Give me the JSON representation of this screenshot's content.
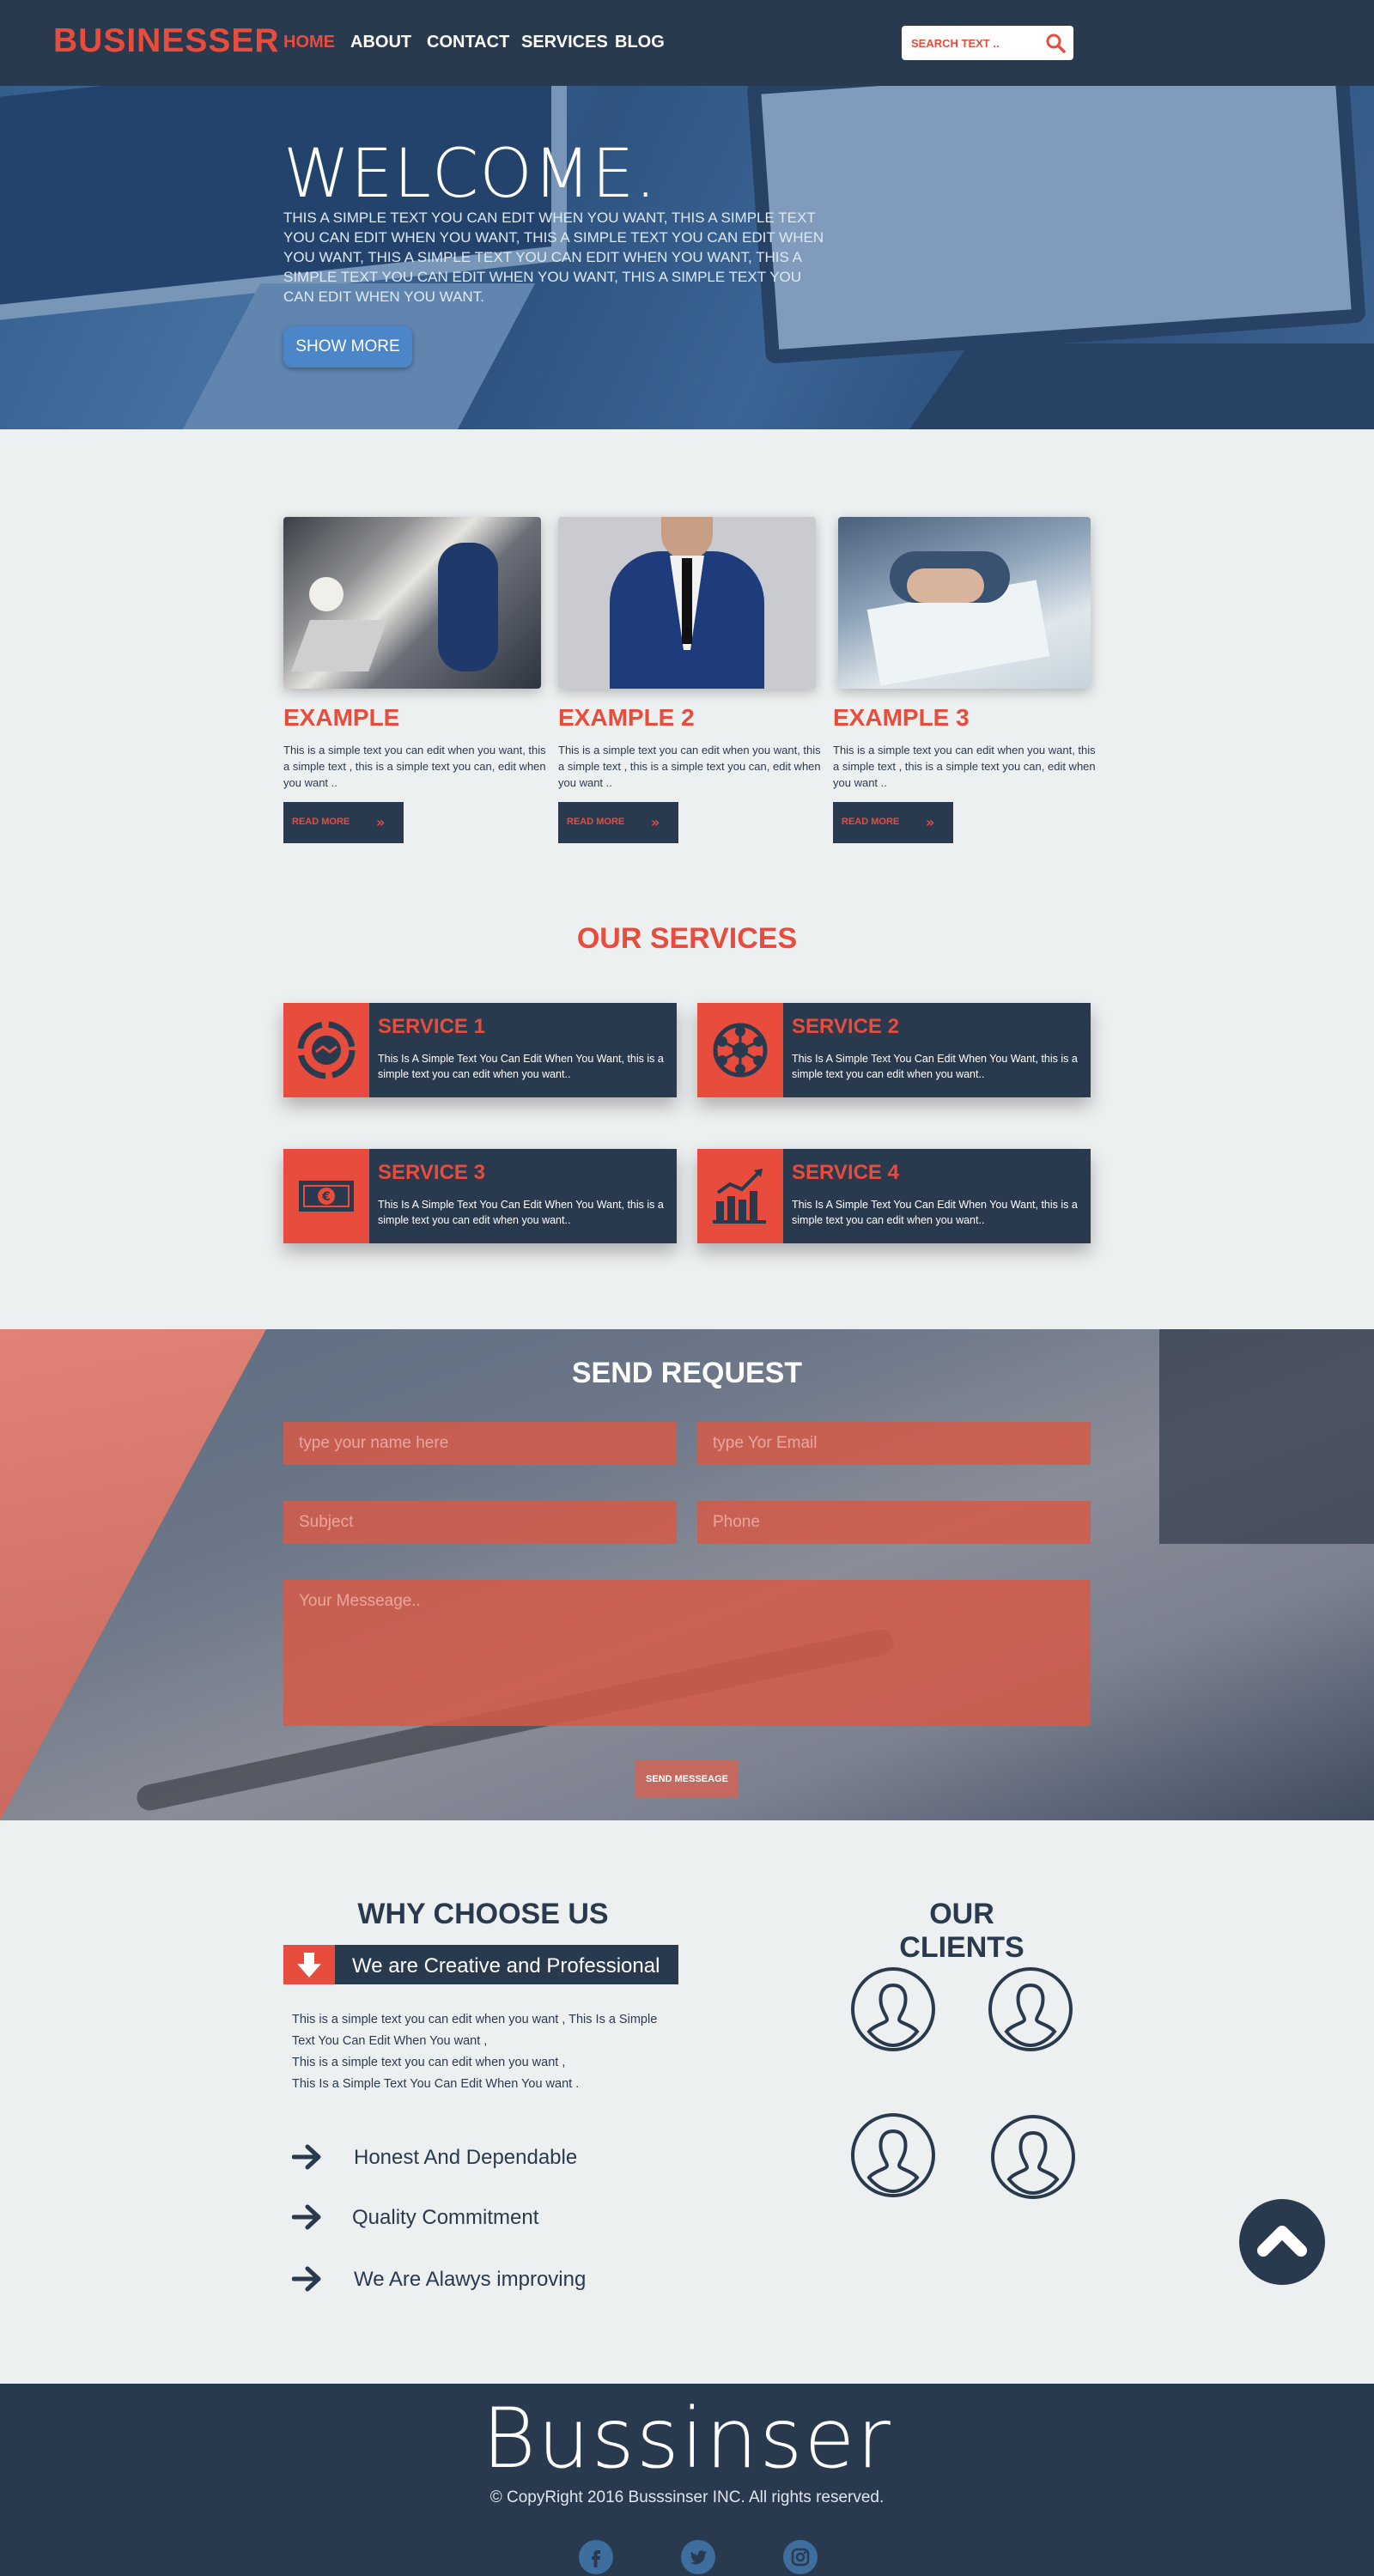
{
  "header": {
    "logo": "BUSINESSER",
    "nav": [
      "HOME",
      "ABOUT",
      "CONTACT",
      "SERVICES",
      "BLOG"
    ],
    "active_nav": "HOME",
    "search_placeholder": "SEARCH TEXT ..",
    "search_icon": "search-icon"
  },
  "hero": {
    "title": "WELCOME.",
    "text": "THIS A SIMPLE TEXT YOU CAN EDIT WHEN YOU WANT, THIS A SIMPLE TEXT YOU CAN EDIT WHEN YOU WANT, THIS A SIMPLE TEXT YOU CAN EDIT WHEN YOU WANT, THIS A SIMPLE TEXT YOU CAN EDIT WHEN YOU WANT, THIS A SIMPLE TEXT YOU CAN EDIT WHEN YOU WANT, THIS A SIMPLE TEXT YOU CAN EDIT WHEN YOU WANT.",
    "button": "SHOW MORE"
  },
  "examples": [
    {
      "title": "EXAMPLE",
      "text": "This is a simple text you can edit when you want, this a simple text , this is a simple text you can, edit when you want ..",
      "button": "READ MORE"
    },
    {
      "title": "EXAMPLE 2",
      "text": "This is a simple text you can edit when you want, this a simple text , this is a simple text you can, edit when you want ..",
      "button": "READ MORE"
    },
    {
      "title": "EXAMPLE 3",
      "text": "This is a simple text you can edit when you want, this a simple text , this is a simple text you can, edit when you want ..",
      "button": "READ MORE"
    }
  ],
  "services": {
    "title": "OUR SERVICES",
    "items": [
      {
        "title": "SERVICE 1",
        "text": "This Is A Simple Text You Can Edit When You Want, this is a simple text you can edit when you want..",
        "icon": "handshake-icon"
      },
      {
        "title": "SERVICE 2",
        "text": "This Is A Simple Text You Can Edit When You Want, this is a simple text you can edit when you want..",
        "icon": "network-icon"
      },
      {
        "title": "SERVICE 3",
        "text": "This Is A Simple Text You Can Edit When You Want, this is a simple text you can edit when you want..",
        "icon": "euro-banknote-icon"
      },
      {
        "title": "SERVICE 4",
        "text": "This Is A Simple Text You Can Edit When You Want, this is a simple text you can edit when you want..",
        "icon": "growth-chart-icon"
      }
    ]
  },
  "request": {
    "title": "SEND REQUEST",
    "name_placeholder": "type your name here",
    "email_placeholder": "type Yor Email",
    "subject_placeholder": "Subject",
    "phone_placeholder": "Phone",
    "message_placeholder": "Your Messeage..",
    "button": "SEND MESSEAGE"
  },
  "why": {
    "title": "WHY CHOOSE US",
    "bar_label": "We are Creative and Professional",
    "text_lines": [
      "This is a simple text you can edit when you want , This Is  a Simple",
      "Text You Can Edit When You want ,",
      "This is a simple text you can edit when you want ,",
      "This Is  a Simple Text You Can Edit When You want ."
    ],
    "items": [
      "Honest And Dependable",
      "Quality Commitment",
      "We Are Alawys improving"
    ]
  },
  "clients": {
    "title": "OUR CLIENTS"
  },
  "footer": {
    "brand": "Bussinser",
    "copyright": "© CopyRight 2016 Busssinser INC. All rights reserved."
  },
  "colors": {
    "accent": "#e74c3c",
    "navy": "#2a3a4e",
    "background": "#edf0f1"
  }
}
